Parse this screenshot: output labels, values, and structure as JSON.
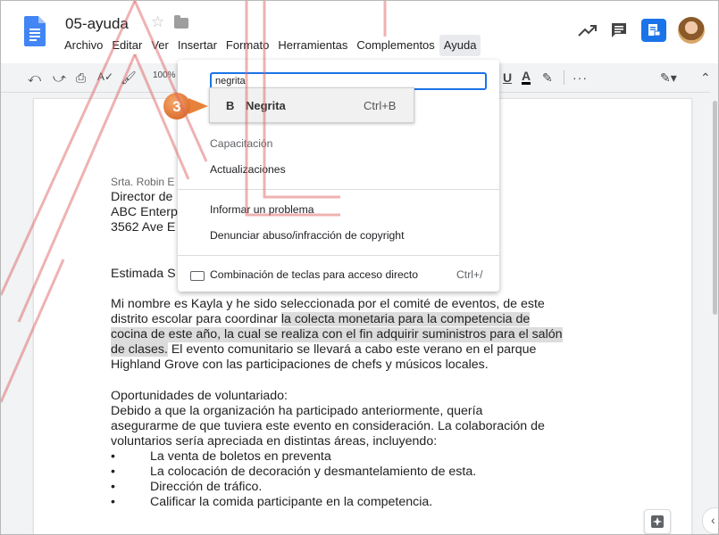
{
  "header": {
    "doc_title": "05-ayuda",
    "menus": [
      "Archivo",
      "Editar",
      "Ver",
      "Insertar",
      "Formato",
      "Herramientas",
      "Complementos",
      "Ayuda"
    ],
    "active_menu": "Ayuda"
  },
  "toolbar": {
    "zoom": "100%"
  },
  "help_menu": {
    "search_value": "negrita",
    "items": {
      "training": "Capacitación",
      "updates": "Actualizaciones",
      "report_problem": "Informar un problema",
      "report_abuse": "Denunciar abuso/infracción de copyright",
      "shortcuts": "Combinación de teclas para acceso directo",
      "shortcuts_key": "Ctrl+/"
    }
  },
  "suggestion": {
    "icon": "B",
    "label": "Negrita",
    "shortcut": "Ctrl+B"
  },
  "callout_step": "3",
  "document": {
    "address": [
      "Srta. Robin E",
      "Director de",
      "ABC Enterp",
      "3562 Ave E"
    ],
    "greeting": "Estimada S",
    "para1": {
      "l1": "Mi nombre es Kayla y he sido seleccionada por el comité de eventos, de este",
      "l2a": "distrito escolar para coordinar ",
      "l2b": "la colecta monetaria para la competencia de",
      "l3": "cocina de este año, la cual se realiza con el fin adquirir suministros para el salón",
      "l4a": "de clases.",
      "l4b": " El evento comunitario se llevará a cabo este verano en el parque",
      "l5": "Highland Grove con las participaciones de chefs y músicos locales."
    },
    "para2": {
      "heading": "Oportunidades de voluntariado:",
      "l1": "Debido a que la organización ha participado anteriormente, quería",
      "l2": "asegurarme de que tuviera este evento en consideración. La colaboración de",
      "l3": "voluntarios sería apreciada en distintas áreas, incluyendo:"
    },
    "bullet_char": "•",
    "bullets": [
      "La venta de boletos en preventa",
      "La colocación de decoración y desmantelamiento de esta.",
      "Dirección de tráfico.",
      "Calificar la comida participante en la competencia."
    ]
  },
  "colors": {
    "accent": "#1a73e8",
    "callout": "#e8823a",
    "watermark": "#e06565"
  }
}
